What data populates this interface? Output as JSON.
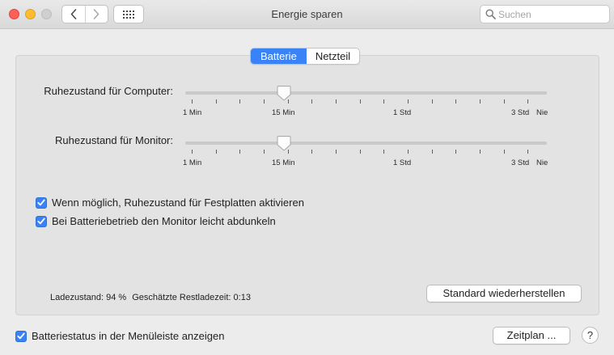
{
  "window": {
    "title": "Energie sparen"
  },
  "search": {
    "placeholder": "Suchen"
  },
  "tabs": [
    {
      "label": "Batterie",
      "active": true
    },
    {
      "label": "Netzteil",
      "active": false
    }
  ],
  "sliders": {
    "computer": {
      "label": "Ruhezustand für Computer:",
      "value": "15 Min"
    },
    "monitor": {
      "label": "Ruhezustand für Monitor:",
      "value": "15 Min"
    },
    "tick_labels": [
      "1 Min",
      "15 Min",
      "1 Std",
      "3 Std",
      "Nie"
    ]
  },
  "checkboxes": {
    "disk_sleep": {
      "label": "Wenn möglich, Ruhezustand für Festplatten aktivieren",
      "checked": true
    },
    "dim_display": {
      "label": "Bei Batteriebetrieb den Monitor leicht abdunkeln",
      "checked": true
    },
    "menubar_status": {
      "label": "Batteriestatus in der Menüleiste anzeigen",
      "checked": true
    }
  },
  "status": {
    "charge": "Ladezustand: 94 %",
    "remaining": "Geschätzte Restladezeit: 0:13"
  },
  "buttons": {
    "restore_defaults": "Standard wiederherstellen",
    "schedule": "Zeitplan ...",
    "help": "?"
  },
  "colors": {
    "accent": "#3a83f6",
    "close": "#fe5f57",
    "minimize": "#febc2e"
  }
}
